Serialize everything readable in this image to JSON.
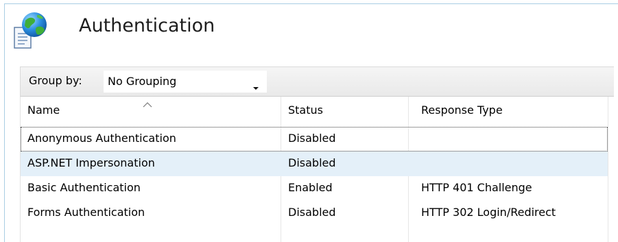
{
  "header": {
    "title": "Authentication",
    "icon": "authentication-globe-page-icon"
  },
  "toolbar": {
    "group_by_label": "Group by:",
    "group_by_value": "No Grouping"
  },
  "grid": {
    "columns": [
      "Name",
      "Status",
      "Response Type"
    ],
    "rows": [
      {
        "name": "Anonymous Authentication",
        "status": "Disabled",
        "response_type": ""
      },
      {
        "name": "ASP.NET Impersonation",
        "status": "Disabled",
        "response_type": ""
      },
      {
        "name": "Basic Authentication",
        "status": "Enabled",
        "response_type": "HTTP 401 Challenge"
      },
      {
        "name": "Forms Authentication",
        "status": "Disabled",
        "response_type": "HTTP 302 Login/Redirect"
      }
    ]
  },
  "colors": {
    "selected_row": "#e4f0f9",
    "frame_border": "#a9cde4",
    "toolbar_bg": "#ececec"
  }
}
